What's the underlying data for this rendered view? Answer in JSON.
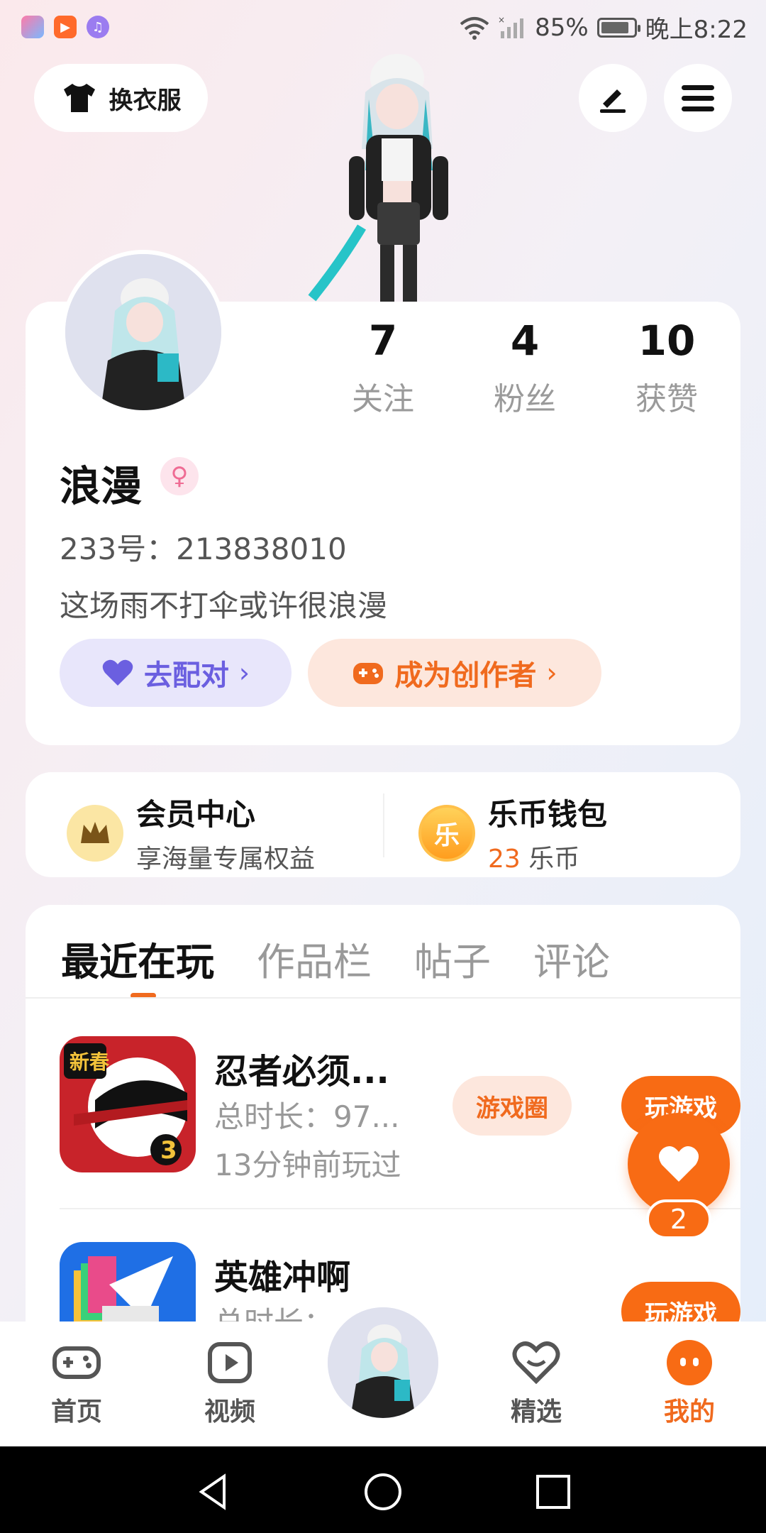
{
  "status_bar": {
    "battery": "85%",
    "time": "晚上8:22"
  },
  "header": {
    "outfit_label": "换衣服"
  },
  "profile": {
    "stats": [
      {
        "value": "7",
        "label": "关注"
      },
      {
        "value": "4",
        "label": "粉丝"
      },
      {
        "value": "10",
        "label": "获赞"
      }
    ],
    "username": "浪漫",
    "uid": "233号：213838010",
    "bio": "这场雨不打伞或许很浪漫",
    "match_label": "去配对",
    "creator_label": "成为创作者"
  },
  "perks": {
    "member_title": "会员中心",
    "member_sub": "享海量专属权益",
    "wallet_title": "乐币钱包",
    "wallet_amount": "23",
    "wallet_unit": "乐币",
    "coin_glyph": "乐"
  },
  "tabs": [
    "最近在玩",
    "作品栏",
    "帖子",
    "评论"
  ],
  "games": [
    {
      "name": "忍者必须...",
      "duration": "总时长：97...",
      "last_played": "13分钟前玩过",
      "circle_label": "游戏圈",
      "play_label": "玩游戏"
    },
    {
      "name": "英雄冲啊",
      "duration": "总时长：",
      "play_label": "玩游戏"
    }
  ],
  "like_count": "2",
  "bottom_nav": [
    {
      "label": "首页"
    },
    {
      "label": "视频"
    },
    {
      "label": "精选"
    },
    {
      "label": "我的"
    }
  ],
  "colors": {
    "accent": "#f86b14",
    "purple": "#6b5fe0",
    "muted": "#999999"
  }
}
